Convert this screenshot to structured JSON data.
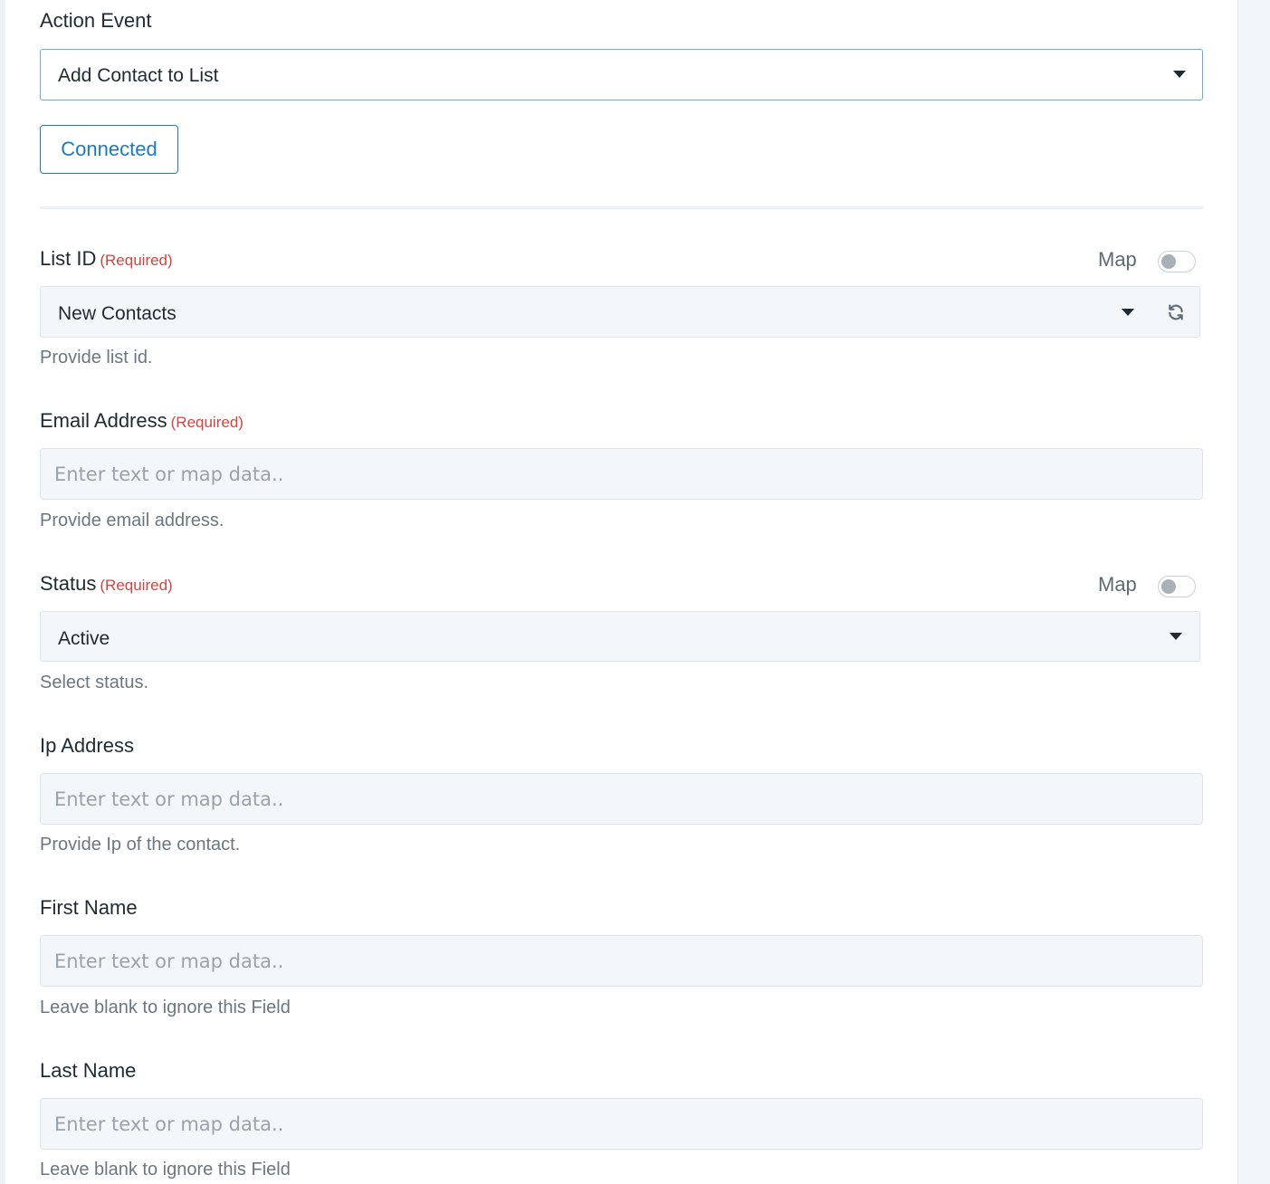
{
  "action_event": {
    "label": "Action Event",
    "selected": "Add Contact to List",
    "connected_label": "Connected"
  },
  "fields": {
    "list_id": {
      "label": "List ID",
      "required": "(Required)",
      "map_label": "Map",
      "map_enabled": false,
      "selected": "New Contacts",
      "help": "Provide list id.",
      "refresh_icon": "refresh-icon"
    },
    "email": {
      "label": "Email Address",
      "required": "(Required)",
      "placeholder": "Enter text or map data..",
      "value": "",
      "help": "Provide email address."
    },
    "status": {
      "label": "Status",
      "required": "(Required)",
      "map_label": "Map",
      "map_enabled": false,
      "selected": "Active",
      "help": "Select status."
    },
    "ip_address": {
      "label": "Ip Address",
      "placeholder": "Enter text or map data..",
      "value": "",
      "help": "Provide Ip of the contact."
    },
    "first_name": {
      "label": "First Name",
      "placeholder": "Enter text or map data..",
      "value": "",
      "help": "Leave blank to ignore this Field"
    },
    "last_name": {
      "label": "Last Name",
      "placeholder": "Enter text or map data..",
      "value": "",
      "help": "Leave blank to ignore this Field"
    }
  },
  "colors": {
    "accent": "#1b7bc2",
    "required": "#d0453f",
    "input_bg": "#f4f7f9",
    "help_text": "#6b7780"
  }
}
